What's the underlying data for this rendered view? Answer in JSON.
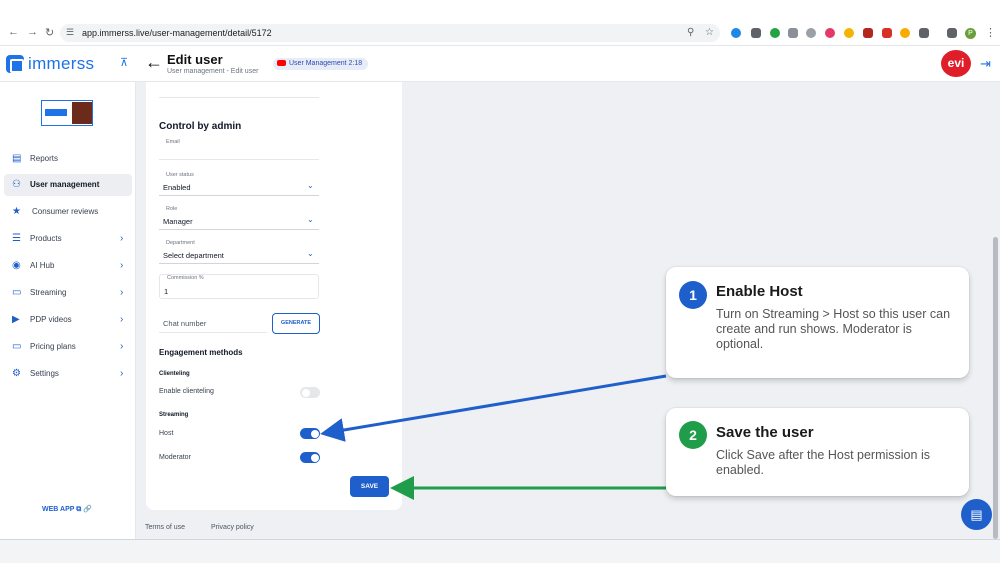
{
  "browser": {
    "url": "app.immerss.live/user-management/detail/5172",
    "back_icon": "arrow-left-icon",
    "forward_icon": "arrow-right-icon",
    "reload_icon": "reload-icon",
    "profile_initial": "P"
  },
  "header": {
    "logo_text": "immerss",
    "title": "Edit user",
    "breadcrumb": "User management - Edit user",
    "video_badge": "User Management 2:18",
    "avatar_text": "evi"
  },
  "sidebar": {
    "items": [
      {
        "label": "Reports",
        "icon": "report-icon"
      },
      {
        "label": "User management",
        "icon": "users-icon"
      },
      {
        "label": "Consumer reviews",
        "icon": "star-icon"
      },
      {
        "label": "Products",
        "icon": "list-icon"
      },
      {
        "label": "AI Hub",
        "icon": "ai-icon"
      },
      {
        "label": "Streaming",
        "icon": "monitor-icon"
      },
      {
        "label": "PDP videos",
        "icon": "video-icon"
      },
      {
        "label": "Pricing plans",
        "icon": "card-icon"
      },
      {
        "label": "Settings",
        "icon": "gear-icon"
      }
    ],
    "active": "User management",
    "web_app": "WEB APP"
  },
  "form": {
    "section_title": "Control by admin",
    "email_label": "Email",
    "user_status": {
      "label": "User status",
      "value": "Enabled"
    },
    "role": {
      "label": "Role",
      "value": "Manager"
    },
    "department": {
      "label": "Department",
      "value": "Select department"
    },
    "commission": {
      "label": "Commission %",
      "value": "1"
    },
    "chat_number_label": "Chat number",
    "generate_label": "GENERATE",
    "engagement_title": "Engagement methods",
    "clienteling_head": "Clienteling",
    "enable_clienteling": {
      "label": "Enable clienteling",
      "on": false
    },
    "streaming_head": "Streaming",
    "host": {
      "label": "Host",
      "on": true
    },
    "moderator": {
      "label": "Moderator",
      "on": true
    },
    "save_label": "SAVE"
  },
  "footer": {
    "terms": "Terms of use",
    "privacy": "Privacy policy"
  },
  "callouts": [
    {
      "number": "1",
      "title": "Enable Host",
      "body": "Turn on Streaming > Host so this user can create and run shows. Moderator is optional.",
      "color": "#1e5fcc"
    },
    {
      "number": "2",
      "title": "Save the user",
      "body": "Click Save after the Host permission is enabled.",
      "color": "#1f9d4a"
    }
  ],
  "colors": {
    "primary": "#1e5fcc",
    "arrow_blue": "#1e5fcc",
    "arrow_green": "#1f9d4a",
    "avatar_red": "#e01e2a"
  }
}
